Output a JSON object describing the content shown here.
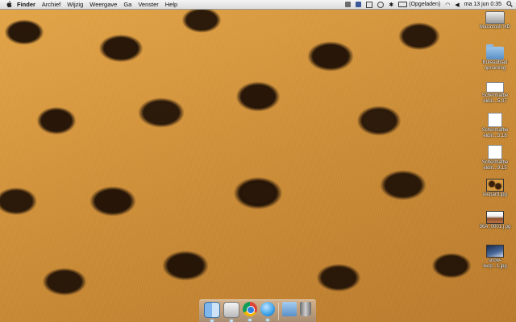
{
  "menubar": {
    "app_name": "Finder",
    "menus": [
      "Archief",
      "Wijzig",
      "Weergave",
      "Ga",
      "Venster",
      "Help"
    ],
    "status": {
      "battery_text": "(Opgeladen)",
      "clock": "ma 13 jun  0:35"
    }
  },
  "desktop": {
    "icons": [
      {
        "label": "Macintosh HD"
      },
      {
        "label": "Bureaublad opruiming"
      },
      {
        "label": "Schermafbe eldin...5.07"
      },
      {
        "label": "Schermafbe eldin...5.18"
      },
      {
        "label": "Schermafbe eldin...9.15"
      },
      {
        "label": "leopard.jpg"
      },
      {
        "label": "36A_0001.j pg"
      },
      {
        "label": "snow-leop...1.jpg"
      }
    ]
  },
  "dock": {
    "items": [
      "finder",
      "preview",
      "chrome",
      "itunes",
      "documents-stack",
      "trash"
    ]
  },
  "colors": {
    "menubar_bg": "#e8e8e8",
    "accent_chrome": "#2d7de0",
    "itunes": "#3aa0e8"
  }
}
